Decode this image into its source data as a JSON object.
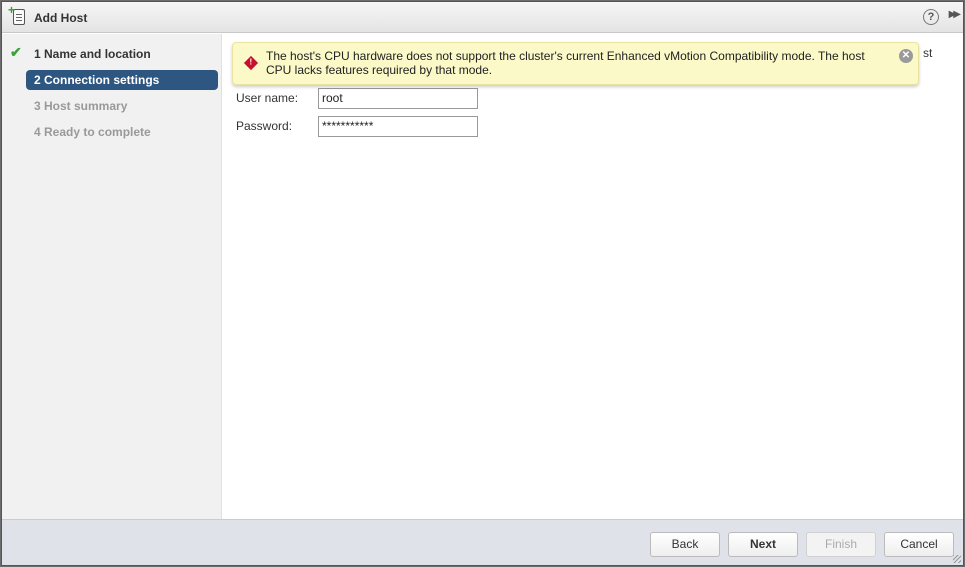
{
  "dialog": {
    "title": "Add Host",
    "help": "?"
  },
  "steps": [
    {
      "label": "1  Name and location",
      "state": "done"
    },
    {
      "label": "2  Connection settings",
      "state": "active"
    },
    {
      "label": "3  Host summary",
      "state": "todo"
    },
    {
      "label": "4  Ready to complete",
      "state": "todo"
    }
  ],
  "warning": {
    "message": "The host's CPU hardware does not support the cluster's current Enhanced vMotion Compatibility mode. The host CPU lacks features required by that mode.",
    "behind_text": "st"
  },
  "form": {
    "username_label": "User name:",
    "username_value": "root",
    "password_label": "Password:",
    "password_value": "***********"
  },
  "footer": {
    "back": "Back",
    "next": "Next",
    "finish": "Finish",
    "cancel": "Cancel"
  }
}
